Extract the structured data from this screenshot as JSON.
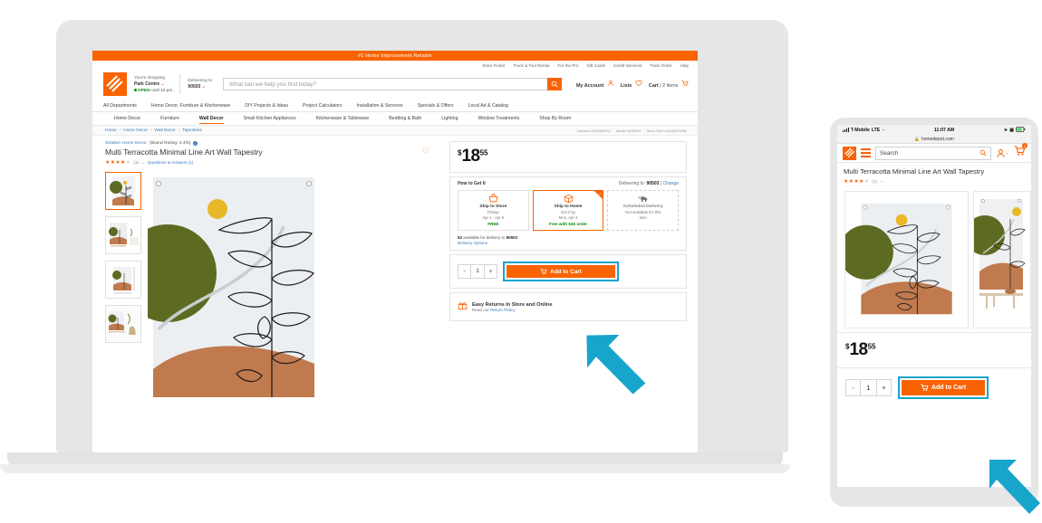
{
  "desktop": {
    "promo_bar": "#1 Home Improvement Retailer",
    "utility_links": [
      "Store Finder",
      "Truck & Tool Rental",
      "For the Pro",
      "Gift Cards",
      "Credit Services",
      "Track Order",
      "Help"
    ],
    "shopping": {
      "label": "You're shopping",
      "store": "Park Centre",
      "status": "OPEN",
      "status_after": "until 10 pm"
    },
    "delivering": {
      "label": "Delivering to",
      "zip": "90503"
    },
    "search_placeholder": "What can we help you find today?",
    "account": {
      "my_account": "My Account",
      "lists": "Lists",
      "cart": "Cart",
      "cart_count": "| 2 items"
    },
    "main_nav": [
      "All Departments",
      "Home Decor, Furniture & Kitchenware",
      "DIY Projects & Ideas",
      "Project Calculators",
      "Installation & Services",
      "Specials & Offers",
      "Local Ad & Catalog"
    ],
    "sub_nav": [
      "Home Decor",
      "Furniture",
      "Wall Decor",
      "Small Kitchen Appliances",
      "Kitchenware & Tableware",
      "Bedding & Bath",
      "Lighting",
      "Window Treatments",
      "Shop By Room"
    ],
    "sub_nav_active": "Wall Decor",
    "breadcrumbs": [
      "Home",
      "Home Decor",
      "Wall Decor",
      "Tapestries"
    ],
    "skus": [
      "Internet #316382944",
      "Model #536941",
      "Store SKU #1008223286"
    ],
    "product": {
      "brand": "Stratton Home Decor",
      "brand_rating": "(Brand Rating: 4.4/5)",
      "title": "Multi Terracotta Minimal Line Art Wall Tapestry",
      "rating_count": "(1)",
      "questions": "Questions & Answers (1)",
      "price_currency": "$",
      "price_whole": "18",
      "price_cents": "55"
    },
    "how_to_get_it": {
      "heading": "How to Get It",
      "delivering_label": "Delivering to:",
      "zip": "90503",
      "change": "Change",
      "options": [
        {
          "title": "Ship to Store",
          "line1": "Pickup",
          "line2": "Apr 1 - Apr 6",
          "note": "FREE",
          "icon": "store-pickup-icon",
          "state": "available"
        },
        {
          "title": "Ship to Home",
          "line1": "Get it by",
          "line2": "Mon, Apr 4",
          "note": "Free with $45 order",
          "icon": "box-icon",
          "state": "selected"
        },
        {
          "title": "Scheduled Delivery",
          "line1": "Not available for this",
          "line2": "item",
          "note": "",
          "icon": "truck-icon",
          "state": "disabled"
        }
      ],
      "availability_count": "52",
      "availability_text": "available for delivery to",
      "availability_zip": "90503",
      "delivery_options_link": "Delivery Options"
    },
    "cart": {
      "minus": "-",
      "quantity": "1",
      "plus": "+",
      "add_to_cart": "Add to Cart"
    },
    "returns": {
      "title": "Easy Returns In Store and Online",
      "sub_prefix": "Read our ",
      "sub_link": "Return Policy"
    }
  },
  "mobile": {
    "status_bar": {
      "carrier": "T-Mobile",
      "network": "LTE",
      "time": "11:07 AM"
    },
    "url": "homedepot.com",
    "search_placeholder": "Search",
    "cart_badge": "2",
    "product": {
      "title": "Multi Terracotta Minimal Line Art Wall Tapestry",
      "rating_count": "(1)",
      "price_currency": "$",
      "price_whole": "18",
      "price_cents": "55"
    },
    "cart": {
      "minus": "-",
      "quantity": "1",
      "plus": "+",
      "add_to_cart": "Add to Cart"
    }
  },
  "annotation": {
    "highlight_color": "#18a5cc",
    "accent_color": "#f96302"
  }
}
